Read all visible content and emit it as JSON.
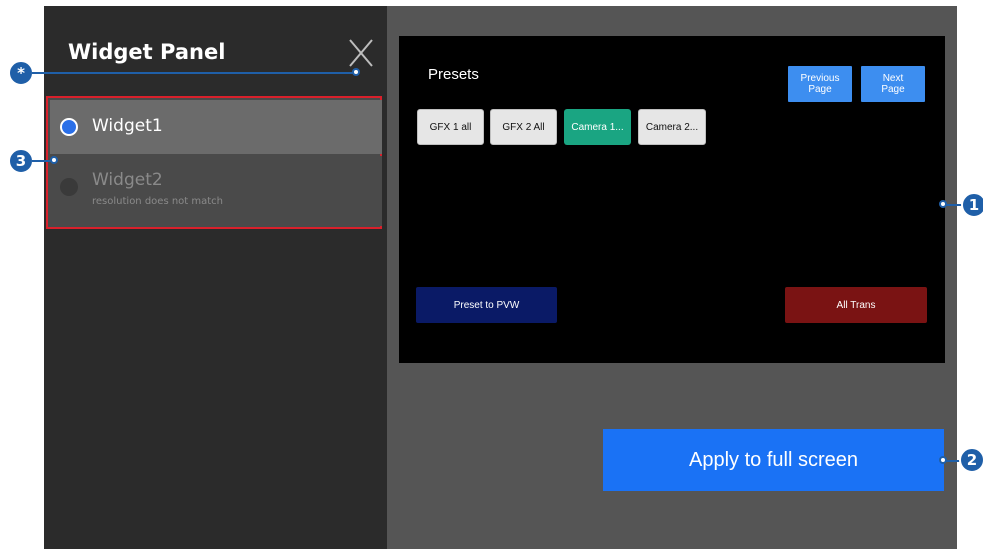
{
  "panel": {
    "title": "Widget Panel",
    "close_icon": "close-icon",
    "items": [
      {
        "name": "Widget1",
        "sub": "",
        "selected": true
      },
      {
        "name": "Widget2",
        "sub": "resolution does not match",
        "selected": false
      }
    ]
  },
  "preview": {
    "presets_label": "Presets",
    "prev_page": "Previous\nPage",
    "next_page": "Next\nPage",
    "presets": [
      "GFX 1 all",
      "GFX 2 All",
      "Camera 1...",
      "Camera 2..."
    ],
    "preset_to_pvw": "Preset to PVW",
    "all_trans": "All Trans"
  },
  "apply_label": "Apply to full screen",
  "callouts": [
    "*",
    "3",
    "1",
    "2"
  ],
  "colors": {
    "panel_bg": "#2b2b2b",
    "main_bg": "#555555",
    "accent_blue": "#1a72f5",
    "selected_preset": "#1aa582",
    "preset_to_pvw_bg": "#0a1a66",
    "all_trans_bg": "#7a1313",
    "highlight_frame": "#d9202b",
    "callout": "#1f5fa8"
  }
}
